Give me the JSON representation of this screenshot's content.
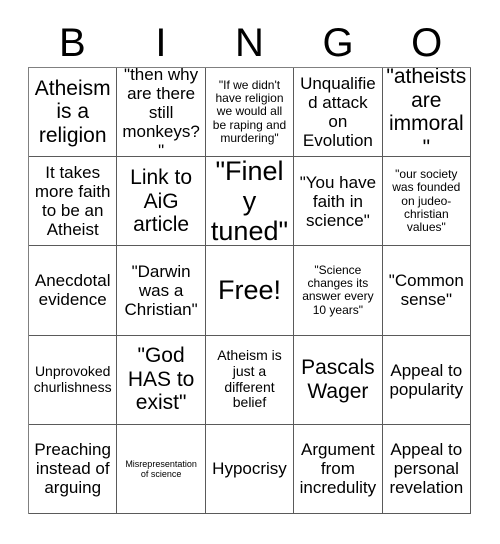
{
  "card": {
    "header_letters": [
      "B",
      "I",
      "N",
      "G",
      "O"
    ],
    "columns": 5,
    "rows": 5,
    "colors": {
      "background": "#ffffff",
      "text": "#000000",
      "grid_line": "#5a5a5a"
    },
    "cells": [
      {
        "text": "Atheism is a religion",
        "size": "fs-lg"
      },
      {
        "text": "\"then why are there still monkeys?\"",
        "size": "fs-md"
      },
      {
        "text": "\"If we didn't have religion we would all be raping and murdering\"",
        "size": "fs-xs"
      },
      {
        "text": "Unqualified attack on Evolution",
        "size": "fs-md"
      },
      {
        "text": "\"atheists are immoral\"",
        "size": "fs-lg"
      },
      {
        "text": "It takes more faith to be an Atheist",
        "size": "fs-md"
      },
      {
        "text": "Link to AiG article",
        "size": "fs-lg"
      },
      {
        "text": "\"Finely tuned\"",
        "size": "fs-xl"
      },
      {
        "text": "\"You have faith in science\"",
        "size": "fs-md"
      },
      {
        "text": "\"our society was founded on judeo-christian values\"",
        "size": "fs-xs"
      },
      {
        "text": "Anecdotal evidence",
        "size": "fs-md"
      },
      {
        "text": "\"Darwin was a Christian\"",
        "size": "fs-md"
      },
      {
        "text": "Free!",
        "size": "fs-xl"
      },
      {
        "text": "\"Science changes its answer every 10 years\"",
        "size": "fs-xs"
      },
      {
        "text": "\"Common sense\"",
        "size": "fs-md"
      },
      {
        "text": "Unprovoked churlishness",
        "size": "fs-sm"
      },
      {
        "text": "\"God HAS to exist\"",
        "size": "fs-lg"
      },
      {
        "text": "Atheism is just a different belief",
        "size": "fs-sm"
      },
      {
        "text": "Pascals Wager",
        "size": "fs-lg"
      },
      {
        "text": "Appeal to popularity",
        "size": "fs-md"
      },
      {
        "text": "Preaching instead of arguing",
        "size": "fs-md"
      },
      {
        "text": "Misrepresentation of science",
        "size": "fs-xxs"
      },
      {
        "text": "Hypocrisy",
        "size": "fs-md"
      },
      {
        "text": "Argument from incredulity",
        "size": "fs-md"
      },
      {
        "text": "Appeal to personal revelation",
        "size": "fs-md"
      }
    ]
  }
}
